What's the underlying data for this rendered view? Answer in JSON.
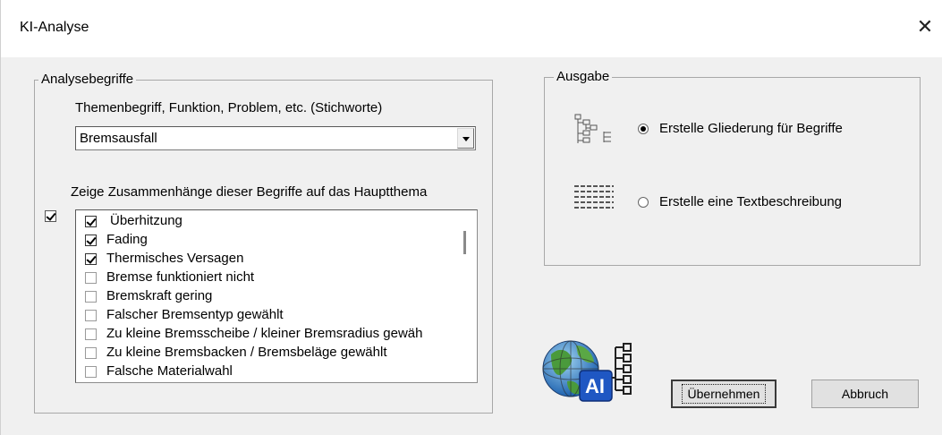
{
  "window": {
    "title": "KI-Analyse",
    "close_glyph": "✕"
  },
  "analysis": {
    "group_label": "Analysebegriffe",
    "term_label": "Themenbegriff, Funktion, Problem, etc. (Stichworte)",
    "term_value": "Bremsausfall",
    "relations_label": "Zeige Zusammenhänge dieser Begriffe auf das Hauptthema",
    "master_checked": true,
    "items": [
      {
        "label": "Überhitzung",
        "checked": true
      },
      {
        "label": "Fading",
        "checked": true
      },
      {
        "label": "Thermisches Versagen",
        "checked": true
      },
      {
        "label": "Bremse funktioniert nicht",
        "checked": false
      },
      {
        "label": "Bremskraft gering",
        "checked": false
      },
      {
        "label": "Falscher Bremsentyp gewählt",
        "checked": false
      },
      {
        "label": "Zu kleine Bremsscheibe / kleiner Bremsradius gewäh",
        "checked": false
      },
      {
        "label": "Zu kleine Bremsbacken / Bremsbeläge gewählt",
        "checked": false
      },
      {
        "label": "Falsche Materialwahl",
        "checked": false
      }
    ]
  },
  "output": {
    "group_label": "Ausgabe",
    "option_outline": "Erstelle Gliederung  für Begriffe",
    "option_text": "Erstelle eine Textbeschreibung",
    "selected": "outline",
    "icons": {
      "outline": "outline-tree-icon",
      "text": "text-lines-icon",
      "logo": "ai-globe-logo"
    },
    "logo_text": "AI"
  },
  "buttons": {
    "apply": "Übernehmen",
    "cancel": "Abbruch"
  },
  "colors": {
    "logo_blue": "#1f57c3",
    "globe_green": "#4a9a3c"
  }
}
